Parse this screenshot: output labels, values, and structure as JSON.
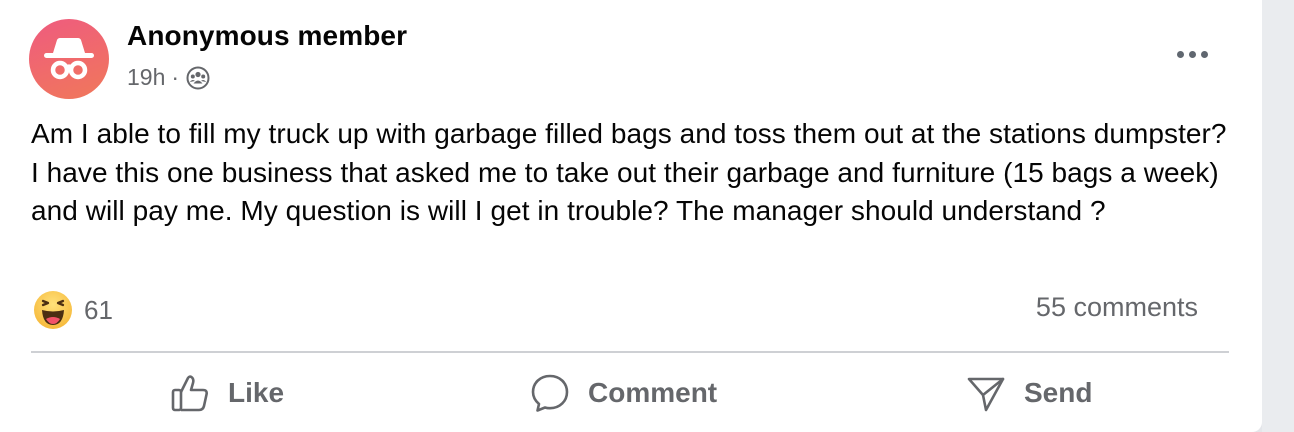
{
  "post": {
    "author": "Anonymous member",
    "timestamp": "19h",
    "separator": "·",
    "audience_icon": "group-icon",
    "avatar_icon": "incognito-icon",
    "more_icon": "more-options-icon",
    "body": "Am I able to fill my truck up with garbage filled bags and toss them out at the stations dumpster? I have this one business that asked me to take out their garbage and furniture (15 bags a week) and will pay me. My question is will I get in trouble? The manager should understand ?",
    "reaction_icon": "haha-emoji-icon",
    "reaction_count": "61",
    "comments_count": "55 comments"
  },
  "actions": {
    "like_label": "Like",
    "comment_label": "Comment",
    "send_label": "Send"
  },
  "colors": {
    "avatar_gradient_start": "#ef5b7f",
    "avatar_gradient_end": "#f0785a",
    "secondary_text": "#65676b",
    "divider": "#ced0d4"
  }
}
